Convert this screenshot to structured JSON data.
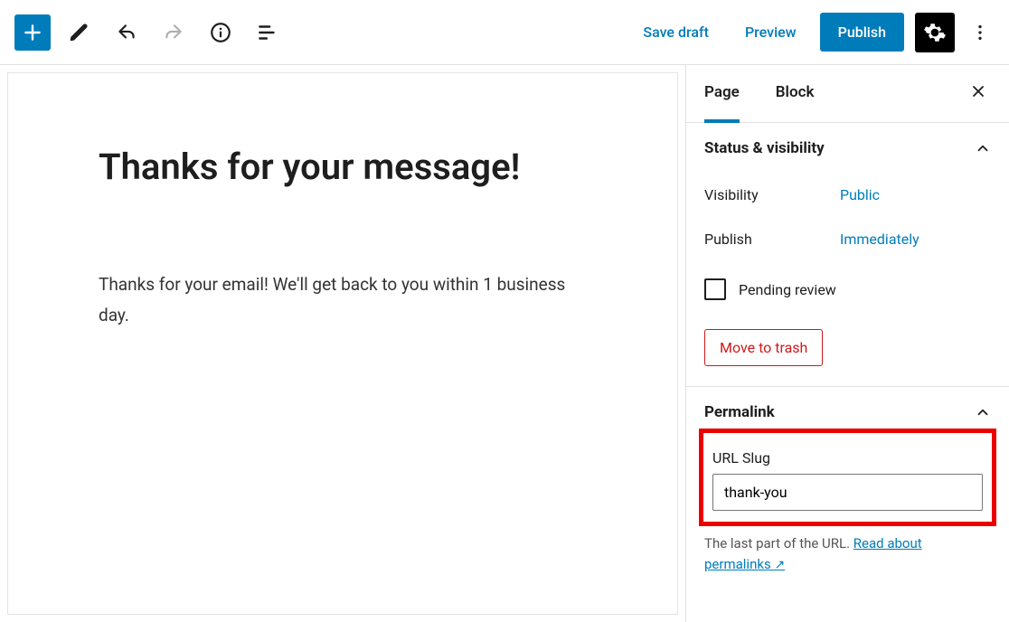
{
  "toolbar": {
    "save_draft": "Save draft",
    "preview": "Preview",
    "publish": "Publish"
  },
  "editor": {
    "page_title": "Thanks for your message!",
    "page_body": "Thanks for your email! We'll get back to you within 1 business day."
  },
  "sidebar": {
    "tabs": {
      "page": "Page",
      "block": "Block"
    },
    "status_visibility": {
      "title": "Status & visibility",
      "visibility_label": "Visibility",
      "visibility_value": "Public",
      "publish_label": "Publish",
      "publish_value": "Immediately",
      "pending_review": "Pending review",
      "trash": "Move to trash"
    },
    "permalink": {
      "title": "Permalink",
      "url_slug_label": "URL Slug",
      "url_slug_value": "thank-you",
      "help_prefix": "The last part of the URL. ",
      "help_link": "Read about permalinks"
    }
  }
}
